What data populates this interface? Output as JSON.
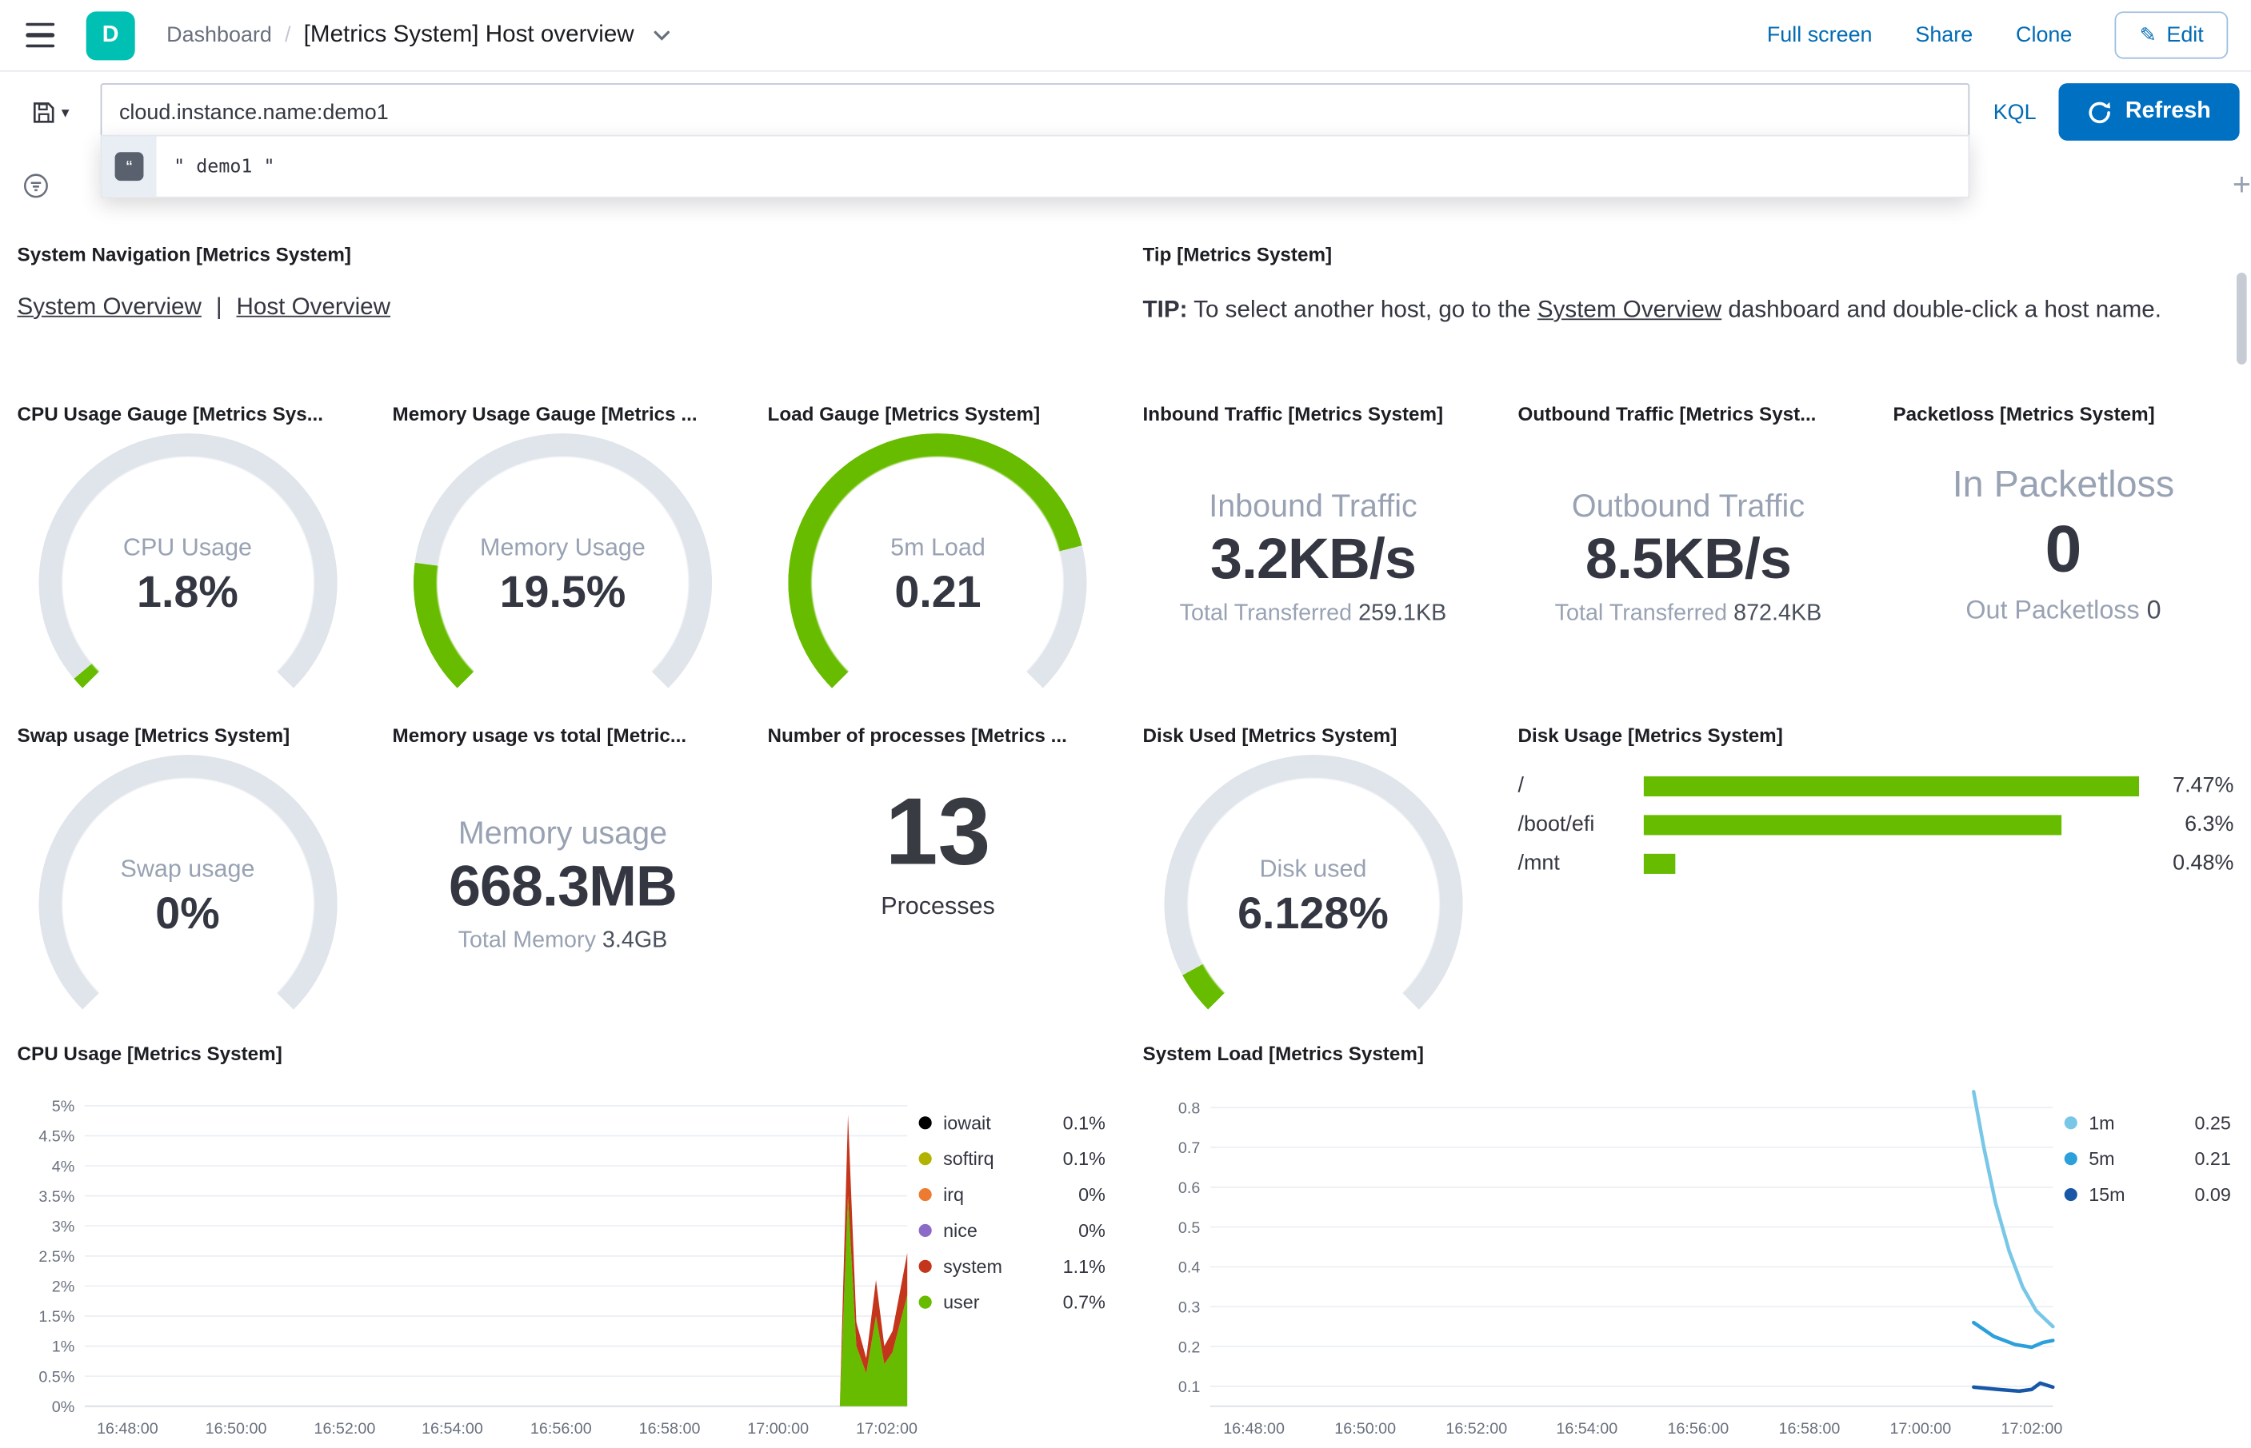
{
  "colors": {
    "primary": "#0071C2",
    "link": "#006BB4",
    "logo_teal": "#00BFB3",
    "gauge_green": "#68BC00",
    "gauge_track": "#E0E4EB",
    "bar_green": "#68BC00"
  },
  "header": {
    "logo_letter": "D",
    "breadcrumb": {
      "root": "Dashboard",
      "separator": "/",
      "current": "[Metrics System] Host overview"
    },
    "actions": {
      "full_screen": "Full screen",
      "share": "Share",
      "clone": "Clone",
      "edit": "Edit"
    }
  },
  "query_bar": {
    "query": "cloud.instance.name:demo1",
    "language_button": "KQL",
    "refresh_button": "Refresh",
    "suggestion_text": "\" demo1 \""
  },
  "panels": {
    "system_navigation": {
      "title": "System Navigation [Metrics System]",
      "link1": "System Overview",
      "separator": "|",
      "link2": "Host Overview"
    },
    "tip": {
      "title": "Tip [Metrics System]",
      "bold": "TIP:",
      "text_before_link": " To select another host, go to the ",
      "link": "System Overview",
      "text_after_link": " dashboard and double-click a host name."
    },
    "cpu_gauge": {
      "title": "CPU Usage Gauge [Metrics Sys...",
      "label": "CPU Usage",
      "value": "1.8%",
      "arc_fraction": 0.018
    },
    "memory_gauge": {
      "title": "Memory Usage Gauge [Metrics ...",
      "label": "Memory Usage",
      "value": "19.5%",
      "arc_fraction": 0.195
    },
    "load_gauge": {
      "title": "Load Gauge [Metrics System]",
      "label": "5m Load",
      "value": "0.21",
      "arc_fraction": 0.78
    },
    "inbound_traffic": {
      "title": "Inbound Traffic [Metrics System]",
      "label": "Inbound Traffic",
      "value": "3.2KB/s",
      "sub_label": "Total Transferred",
      "sub_value": "259.1KB"
    },
    "outbound_traffic": {
      "title": "Outbound Traffic [Metrics Syst...",
      "label": "Outbound Traffic",
      "value": "8.5KB/s",
      "sub_label": "Total Transferred",
      "sub_value": "872.4KB"
    },
    "packetloss": {
      "title": "Packetloss [Metrics System]",
      "in_label": "In Packetloss",
      "in_value": "0",
      "out_label": "Out Packetloss",
      "out_value": "0"
    },
    "swap_gauge": {
      "title": "Swap usage [Metrics System]",
      "label": "Swap usage",
      "value": "0%",
      "arc_fraction": 0
    },
    "memory_vs_total": {
      "title": "Memory usage vs total [Metric...",
      "label": "Memory usage",
      "value": "668.3MB",
      "sub_label": "Total Memory",
      "sub_value": "3.4GB"
    },
    "processes": {
      "title": "Number of processes [Metrics ...",
      "value": "13",
      "label": "Processes"
    },
    "disk_used_gauge": {
      "title": "Disk Used [Metrics System]",
      "label": "Disk used",
      "value": "6.128%",
      "arc_fraction": 0.061
    },
    "disk_usage": {
      "title": "Disk Usage [Metrics System]",
      "scale_max": 7.47,
      "rows": [
        {
          "label": "/",
          "value": "7.47%",
          "pct": 7.47
        },
        {
          "label": "/boot/efi",
          "value": "6.3%",
          "pct": 6.3
        },
        {
          "label": "/mnt",
          "value": "0.48%",
          "pct": 0.48
        }
      ]
    }
  },
  "chart_data": [
    {
      "id": "cpu-usage",
      "type": "area",
      "stacked": true,
      "title": "CPU Usage [Metrics System]",
      "ylim": [
        0,
        5.3
      ],
      "y_ticks": [
        {
          "v": 0,
          "label": "0%"
        },
        {
          "v": 0.5,
          "label": "0.5%"
        },
        {
          "v": 1,
          "label": "1%"
        },
        {
          "v": 1.5,
          "label": "1.5%"
        },
        {
          "v": 2,
          "label": "2%"
        },
        {
          "v": 2.5,
          "label": "2.5%"
        },
        {
          "v": 3,
          "label": "3%"
        },
        {
          "v": 3.5,
          "label": "3.5%"
        },
        {
          "v": 4,
          "label": "4%"
        },
        {
          "v": 4.5,
          "label": "4.5%"
        },
        {
          "v": 5,
          "label": "5%"
        }
      ],
      "x_ticks": [
        {
          "f": 0.052,
          "label": "16:48:00"
        },
        {
          "f": 0.184,
          "label": "16:50:00"
        },
        {
          "f": 0.316,
          "label": "16:52:00"
        },
        {
          "f": 0.447,
          "label": "16:54:00"
        },
        {
          "f": 0.579,
          "label": "16:56:00"
        },
        {
          "f": 0.711,
          "label": "16:58:00"
        },
        {
          "f": 0.843,
          "label": "17:00:00"
        },
        {
          "f": 0.975,
          "label": "17:02:00"
        }
      ],
      "x": [
        0,
        0.9,
        0.918,
        0.928,
        0.938,
        0.95,
        0.962,
        0.972,
        0.982,
        1
      ],
      "series": [
        {
          "name": "user",
          "color": "#68BC00",
          "values": [
            0,
            0,
            0,
            3.5,
            1.0,
            0.55,
            1.5,
            0.7,
            0.9,
            1.85
          ]
        },
        {
          "name": "system",
          "color": "#C4361C",
          "values": [
            0,
            0,
            0,
            1.35,
            0.4,
            0.25,
            0.6,
            0.3,
            0.35,
            0.7
          ]
        }
      ],
      "legend": [
        {
          "label": "iowait",
          "value": "0.1%",
          "color": "#000000"
        },
        {
          "label": "softirq",
          "value": "0.1%",
          "color": "#B2B200"
        },
        {
          "label": "irq",
          "value": "0%",
          "color": "#EC7A30"
        },
        {
          "label": "nice",
          "value": "0%",
          "color": "#8B6BC7"
        },
        {
          "label": "system",
          "value": "1.1%",
          "color": "#C4361C"
        },
        {
          "label": "user",
          "value": "0.7%",
          "color": "#68BC00"
        }
      ]
    },
    {
      "id": "system-load",
      "type": "line",
      "title": "System Load [Metrics System]",
      "ylim": [
        0.05,
        0.85
      ],
      "y_ticks": [
        {
          "v": 0.1,
          "label": "0.1"
        },
        {
          "v": 0.2,
          "label": "0.2"
        },
        {
          "v": 0.3,
          "label": "0.3"
        },
        {
          "v": 0.4,
          "label": "0.4"
        },
        {
          "v": 0.5,
          "label": "0.5"
        },
        {
          "v": 0.6,
          "label": "0.6"
        },
        {
          "v": 0.7,
          "label": "0.7"
        },
        {
          "v": 0.8,
          "label": "0.8"
        }
      ],
      "x_ticks": [
        {
          "f": 0.052,
          "label": "16:48:00"
        },
        {
          "f": 0.184,
          "label": "16:50:00"
        },
        {
          "f": 0.316,
          "label": "16:52:00"
        },
        {
          "f": 0.447,
          "label": "16:54:00"
        },
        {
          "f": 0.579,
          "label": "16:56:00"
        },
        {
          "f": 0.711,
          "label": "16:58:00"
        },
        {
          "f": 0.843,
          "label": "17:00:00"
        },
        {
          "f": 0.975,
          "label": "17:02:00"
        }
      ],
      "series": [
        {
          "name": "1m",
          "color": "#79C7E7",
          "points": [
            [
              0.906,
              0.84
            ],
            [
              0.918,
              0.7
            ],
            [
              0.932,
              0.56
            ],
            [
              0.948,
              0.44
            ],
            [
              0.964,
              0.35
            ],
            [
              0.98,
              0.29
            ],
            [
              1,
              0.25
            ]
          ]
        },
        {
          "name": "5m",
          "color": "#2BA0DA",
          "points": [
            [
              0.906,
              0.26
            ],
            [
              0.93,
              0.225
            ],
            [
              0.955,
              0.205
            ],
            [
              0.975,
              0.198
            ],
            [
              0.988,
              0.21
            ],
            [
              1,
              0.215
            ]
          ]
        },
        {
          "name": "15m",
          "color": "#1757A6",
          "points": [
            [
              0.906,
              0.098
            ],
            [
              0.935,
              0.092
            ],
            [
              0.96,
              0.088
            ],
            [
              0.975,
              0.092
            ],
            [
              0.985,
              0.108
            ],
            [
              1,
              0.098
            ]
          ]
        }
      ],
      "legend": [
        {
          "label": "1m",
          "value": "0.25",
          "color": "#79C7E7"
        },
        {
          "label": "5m",
          "value": "0.21",
          "color": "#2BA0DA"
        },
        {
          "label": "15m",
          "value": "0.09",
          "color": "#1757A6"
        }
      ]
    }
  ]
}
